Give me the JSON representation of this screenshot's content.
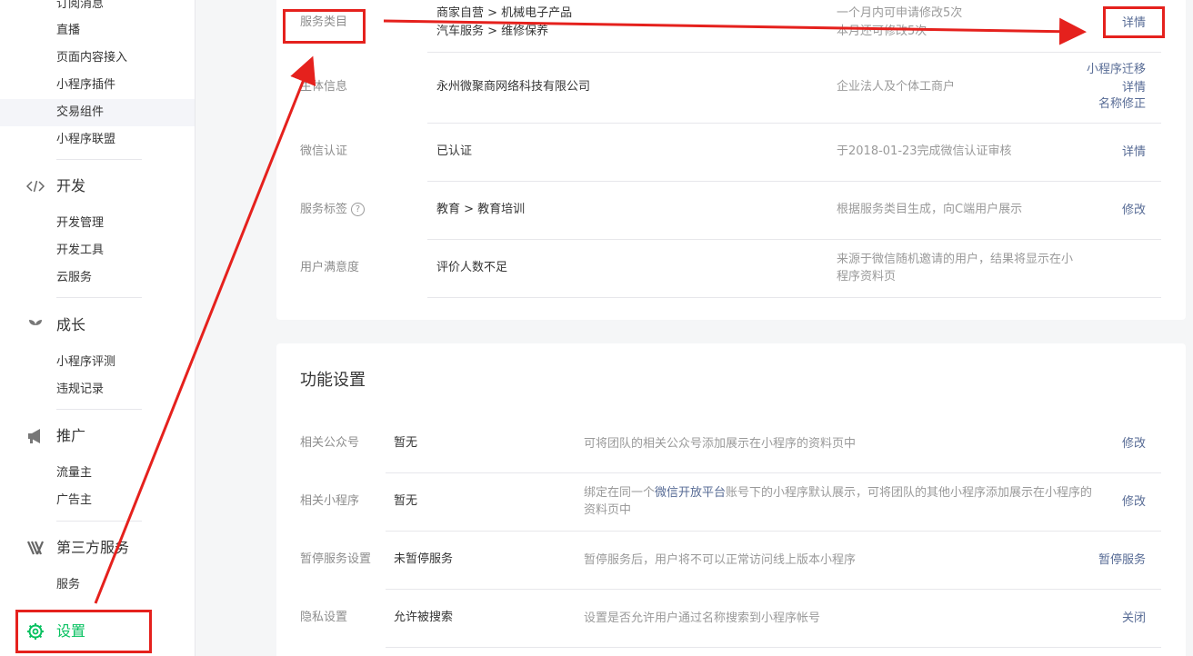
{
  "sidebar": {
    "top_items": [
      {
        "label": "订阅消息"
      },
      {
        "label": "直播"
      },
      {
        "label": "页面内容接入"
      },
      {
        "label": "小程序插件"
      },
      {
        "label": "交易组件"
      },
      {
        "label": "小程序联盟"
      }
    ],
    "sections": [
      {
        "title": "开发",
        "icon": "code-icon",
        "items": [
          {
            "label": "开发管理"
          },
          {
            "label": "开发工具"
          },
          {
            "label": "云服务"
          }
        ]
      },
      {
        "title": "成长",
        "icon": "sprout-icon",
        "items": [
          {
            "label": "小程序评测"
          },
          {
            "label": "违规记录"
          }
        ]
      },
      {
        "title": "推广",
        "icon": "megaphone-icon",
        "items": [
          {
            "label": "流量主"
          },
          {
            "label": "广告主"
          }
        ]
      },
      {
        "title": "第三方服务",
        "icon": "third-party-icon",
        "items": [
          {
            "label": "服务"
          }
        ]
      }
    ],
    "settings": {
      "title": "设置",
      "icon": "gear-icon",
      "color": "#07c160"
    }
  },
  "basic_info": {
    "rows": [
      {
        "label": "服务类目",
        "value_lines": [
          "商家自营 > 机械电子产品",
          "汽车服务 > 维修保养"
        ],
        "desc_lines": [
          "一个月内可申请修改5次",
          "本月还可修改5次"
        ],
        "actions": [
          "详情"
        ]
      },
      {
        "label": "主体信息",
        "value_lines": [
          "永州微聚商网络科技有限公司"
        ],
        "desc_lines": [
          "企业法人及个体工商户"
        ],
        "actions": [
          "小程序迁移",
          "详情",
          "名称修正"
        ]
      },
      {
        "label": "微信认证",
        "value_lines": [
          "已认证"
        ],
        "desc_lines": [
          "于2018-01-23完成微信认证审核"
        ],
        "actions": [
          "详情"
        ]
      },
      {
        "label": "服务标签",
        "value_lines": [
          "教育 > 教育培训"
        ],
        "desc_lines": [
          "根据服务类目生成，向C端用户展示"
        ],
        "actions": [
          "修改"
        ]
      },
      {
        "label": "用户满意度",
        "value_lines": [
          "评价人数不足"
        ],
        "desc_lines": [
          "来源于微信随机邀请的用户，结果将显示在小",
          "程序资料页"
        ],
        "actions": []
      }
    ]
  },
  "function_settings": {
    "title": "功能设置",
    "rows": [
      {
        "label": "相关公众号",
        "value": "暂无",
        "desc_lines": [
          "可将团队的相关公众号添加展示在小程序的资料页中"
        ],
        "action": "修改"
      },
      {
        "label": "相关小程序",
        "value": "暂无",
        "desc_prefix": "绑定在同一个",
        "desc_link": "微信开放平台",
        "desc_suffix": "账号下的小程序默认展示，可将团队的其他小程序添加展示在小程序的",
        "desc_line2": "资料页中",
        "action": "修改"
      },
      {
        "label": "暂停服务设置",
        "value": "未暂停服务",
        "desc_lines": [
          "暂停服务后，用户将不可以正常访问线上版本小程序"
        ],
        "action": "暂停服务"
      },
      {
        "label": "隐私设置",
        "value": "允许被搜索",
        "desc_lines": [
          "设置是否允许用户通过名称搜索到小程序帐号"
        ],
        "action": "关闭"
      }
    ]
  },
  "colors": {
    "link": "#576b95",
    "annotation": "#e5211d",
    "active_green": "#07c160"
  }
}
